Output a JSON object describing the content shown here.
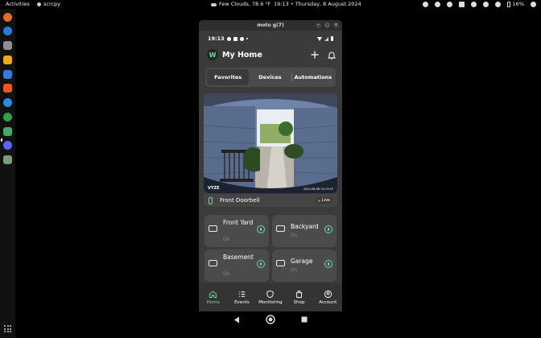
{
  "topbar": {
    "activities": "Activities",
    "app_name": "scrcpy",
    "weather": "Few Clouds, 78.6 °F",
    "clock": "19:13 • Thursday, 8 August 2024",
    "battery": "16%"
  },
  "window": {
    "title": "moto g(7)"
  },
  "phone_status": {
    "time": "19:13"
  },
  "header": {
    "title": "My Home",
    "logo_letter": "W"
  },
  "tabs": [
    "Favorites",
    "Devices",
    "Automations"
  ],
  "camera": {
    "name": "Front Doorbell",
    "live_label": "Live",
    "watermark": "VYZE",
    "timestamp": "2024-08-08 19:13:25"
  },
  "devices": [
    {
      "name": "Front Yard",
      "status": "On"
    },
    {
      "name": "Backyard",
      "status": "On"
    },
    {
      "name": "Basement",
      "status": "On"
    },
    {
      "name": "Garage",
      "status": "On"
    }
  ],
  "nav": [
    "Home",
    "Events",
    "Monitoring",
    "Shop",
    "Account"
  ],
  "colors": {
    "accent": "#6fd9a7",
    "live": "#e34b4b",
    "background": "#3a3b3a",
    "card": "#4a4b4a"
  }
}
